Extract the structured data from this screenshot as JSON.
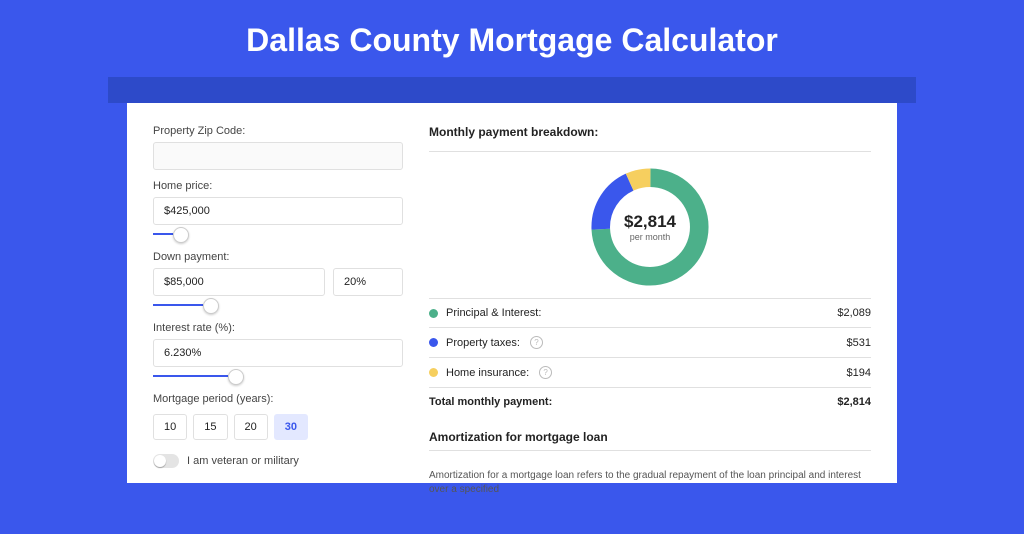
{
  "title": "Dallas County Mortgage Calculator",
  "form": {
    "zip_label": "Property Zip Code:",
    "zip_value": "",
    "home_price_label": "Home price:",
    "home_price_value": "$425,000",
    "home_price_slider_pct": 8,
    "down_label": "Down payment:",
    "down_value": "$85,000",
    "down_pct_value": "20%",
    "down_slider_pct": 20,
    "rate_label": "Interest rate (%):",
    "rate_value": "6.230%",
    "rate_slider_pct": 30,
    "period_label": "Mortgage period (years):",
    "periods": [
      "10",
      "15",
      "20",
      "30"
    ],
    "period_active_index": 3,
    "veteran_label": "I am veteran or military"
  },
  "breakdown": {
    "title": "Monthly payment breakdown:",
    "center_amount": "$2,814",
    "center_sub": "per month",
    "rows": [
      {
        "key": "principal",
        "label": "Principal & Interest:",
        "value": "$2,089",
        "color": "#4cb08a",
        "has_help": false
      },
      {
        "key": "taxes",
        "label": "Property taxes:",
        "value": "$531",
        "color": "#3a57ec",
        "has_help": true
      },
      {
        "key": "insurance",
        "label": "Home insurance:",
        "value": "$194",
        "color": "#f6cf5f",
        "has_help": true
      }
    ],
    "total_label": "Total monthly payment:",
    "total_value": "$2,814"
  },
  "amortization": {
    "title": "Amortization for mortgage loan",
    "text": "Amortization for a mortgage loan refers to the gradual repayment of the loan principal and interest over a specified"
  },
  "chart_data": {
    "type": "pie",
    "title": "Monthly payment breakdown",
    "series": [
      {
        "name": "Principal & Interest",
        "value": 2089,
        "color": "#4cb08a"
      },
      {
        "name": "Property taxes",
        "value": 531,
        "color": "#3a57ec"
      },
      {
        "name": "Home insurance",
        "value": 194,
        "color": "#f6cf5f"
      }
    ],
    "total": 2814,
    "total_label": "per month"
  }
}
